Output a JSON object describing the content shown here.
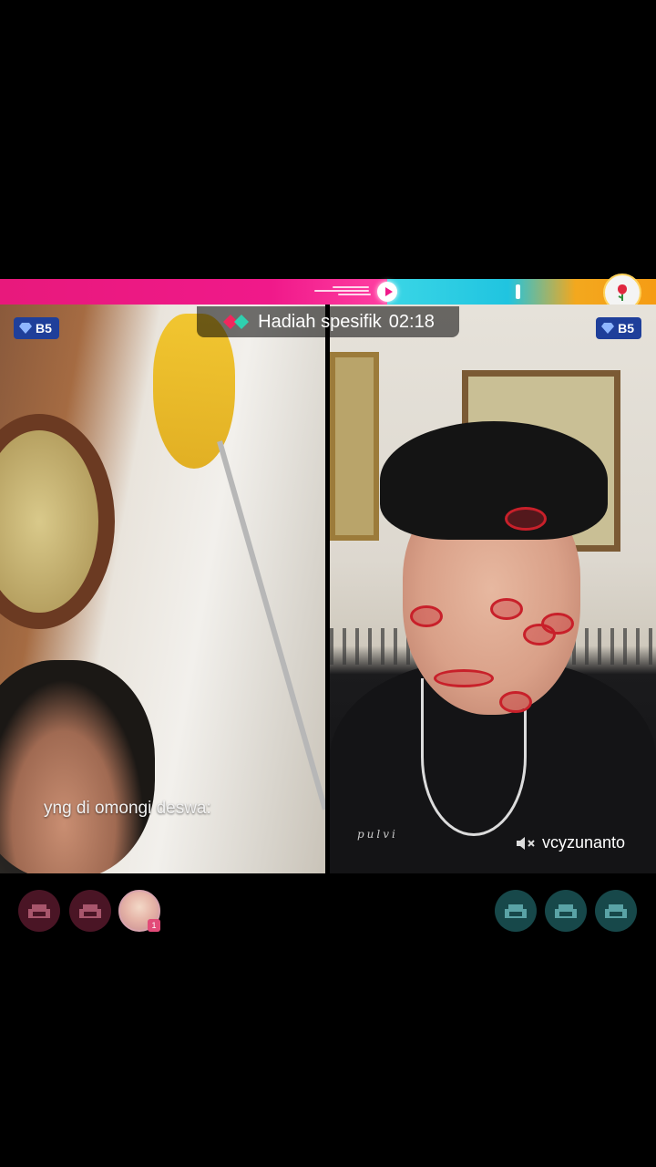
{
  "battle": {
    "left_share": 0.59,
    "colors": {
      "left": "#f0198a",
      "right_start": "#3ad6e6",
      "right_end": "#f59c14"
    }
  },
  "gift_timer": {
    "label": "Hadiah spesifik",
    "time": "02:18",
    "icon": "gift-diamond-icon"
  },
  "left_host": {
    "tier_badge": "B5",
    "caption": "yng di omongi deswa:"
  },
  "right_host": {
    "tier_badge": "B5",
    "username": "vcyzunanto",
    "watermark": "pulvi",
    "muted_icon": "speaker-muted-icon"
  },
  "seats": {
    "left": [
      {
        "type": "empty",
        "icon": "armchair-icon"
      },
      {
        "type": "empty",
        "icon": "armchair-icon"
      },
      {
        "type": "avatar",
        "badge": "1"
      }
    ],
    "right": [
      {
        "type": "empty",
        "icon": "armchair-icon"
      },
      {
        "type": "empty",
        "icon": "armchair-icon"
      },
      {
        "type": "empty",
        "icon": "armchair-icon"
      }
    ]
  }
}
